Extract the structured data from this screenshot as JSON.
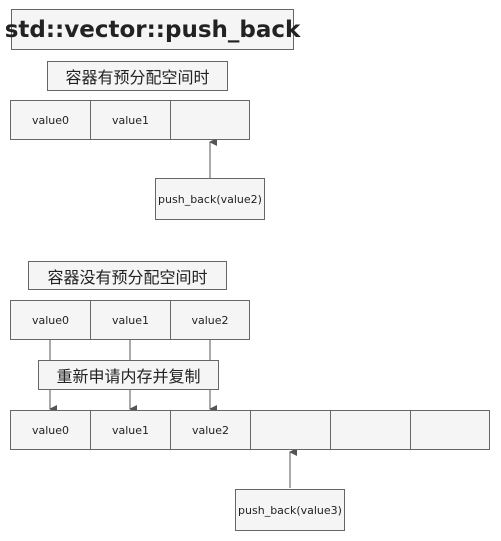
{
  "title": "std::vector::push_back",
  "section1": {
    "label": "容器有预分配空间时",
    "cells": [
      "value0",
      "value1",
      ""
    ],
    "call": "push_back(value2)"
  },
  "section2": {
    "label": "容器没有预分配空间时",
    "old_cells": [
      "value0",
      "value1",
      "value2"
    ],
    "realloc_label": "重新申请内存并复制",
    "new_cells": [
      "value0",
      "value1",
      "value2",
      "",
      "",
      ""
    ],
    "call": "push_back(value3)"
  },
  "colors": {
    "fill": "#f5f5f5",
    "stroke": "#666666",
    "text": "#222222"
  }
}
